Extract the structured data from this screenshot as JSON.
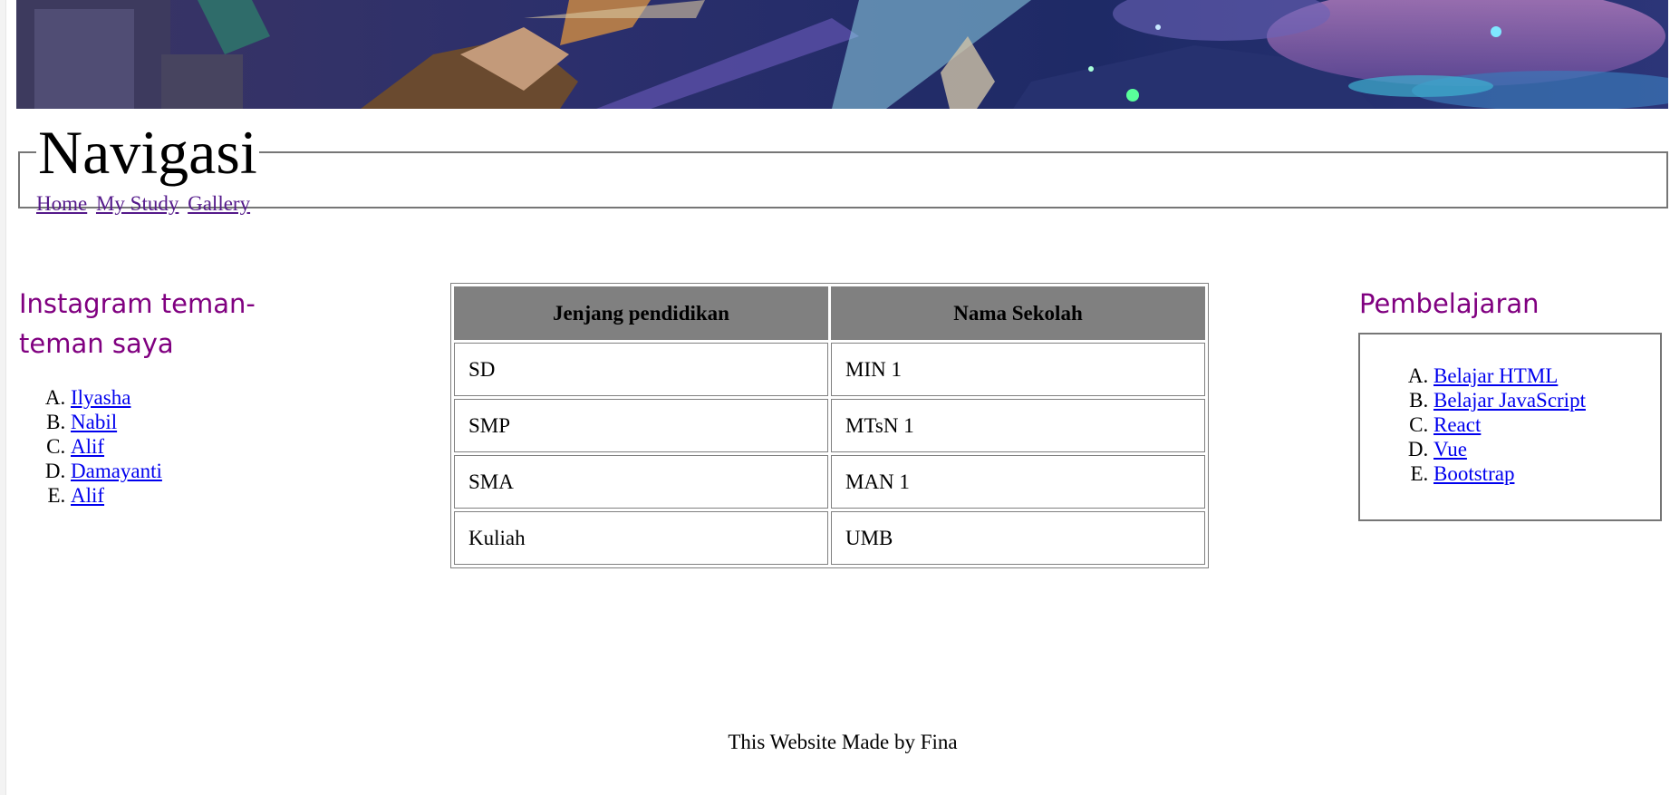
{
  "nav": {
    "legend": "Navigasi",
    "links": [
      "Home",
      "My Study",
      "Gallery"
    ]
  },
  "instagram": {
    "heading": "Instagram teman-teman saya",
    "items": [
      "Ilyasha",
      "Nabil",
      "Alif",
      "Damayanti",
      "Alif"
    ]
  },
  "table": {
    "headers": [
      "Jenjang pendidikan",
      "Nama Sekolah"
    ],
    "rows": [
      [
        "SD",
        "MIN 1"
      ],
      [
        "SMP",
        "MTsN 1"
      ],
      [
        "SMA",
        "MAN 1"
      ],
      [
        "Kuliah",
        "UMB"
      ]
    ]
  },
  "learning": {
    "heading": "Pembelajaran",
    "items": [
      "Belajar HTML",
      "Belajar JavaScript",
      "React",
      "Vue",
      "Bootstrap"
    ]
  },
  "footer": {
    "text": "This Website Made by Fina"
  },
  "colors": {
    "visited_link": "#551a8b",
    "link": "#0000ee",
    "heading": "#800080",
    "table_header_bg": "#808080"
  }
}
